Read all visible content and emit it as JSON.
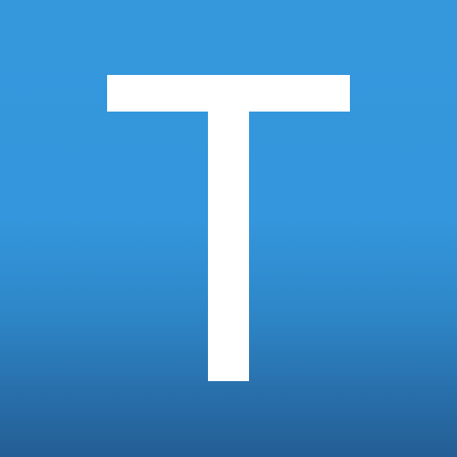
{
  "logo": {
    "letter": "T",
    "letter_color": "#ffffff",
    "gradient_top": "#3598dd",
    "gradient_mid": "#2e87c8",
    "gradient_bottom": "#245e94"
  }
}
